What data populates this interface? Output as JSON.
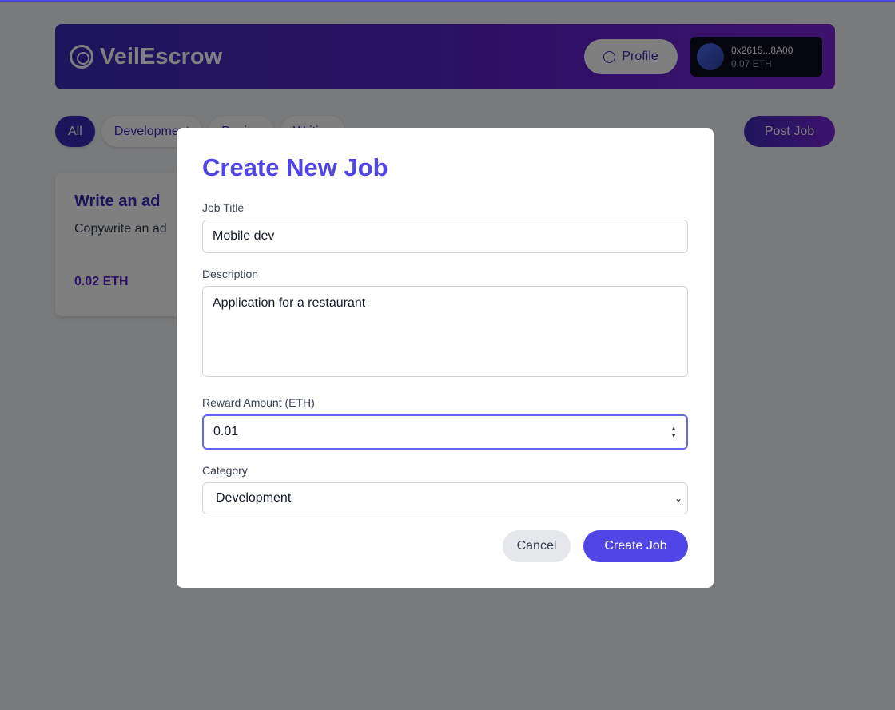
{
  "header": {
    "app_name": "VeilEscrow",
    "profile_label": "Profile",
    "wallet_address": "0x2615...8A00",
    "wallet_balance": "0.07 ETH"
  },
  "filters": [
    {
      "label": "All",
      "active": true
    },
    {
      "label": "Development"
    },
    {
      "label": "Design"
    },
    {
      "label": "Writing"
    }
  ],
  "post_job_label": "Post Job",
  "jobs": [
    {
      "title": "Write an ad",
      "description": "Copywrite an ad",
      "reward": "0.02 ETH"
    }
  ],
  "modal": {
    "title": "Create New Job",
    "job_title_label": "Job Title",
    "job_title_value": "Mobile dev",
    "description_label": "Description",
    "description_value": "Application for a restaurant",
    "reward_label": "Reward Amount (ETH)",
    "reward_value": "0.01",
    "category_label": "Category",
    "category_value": "Development",
    "cancel_label": "Cancel",
    "create_label": "Create Job"
  }
}
